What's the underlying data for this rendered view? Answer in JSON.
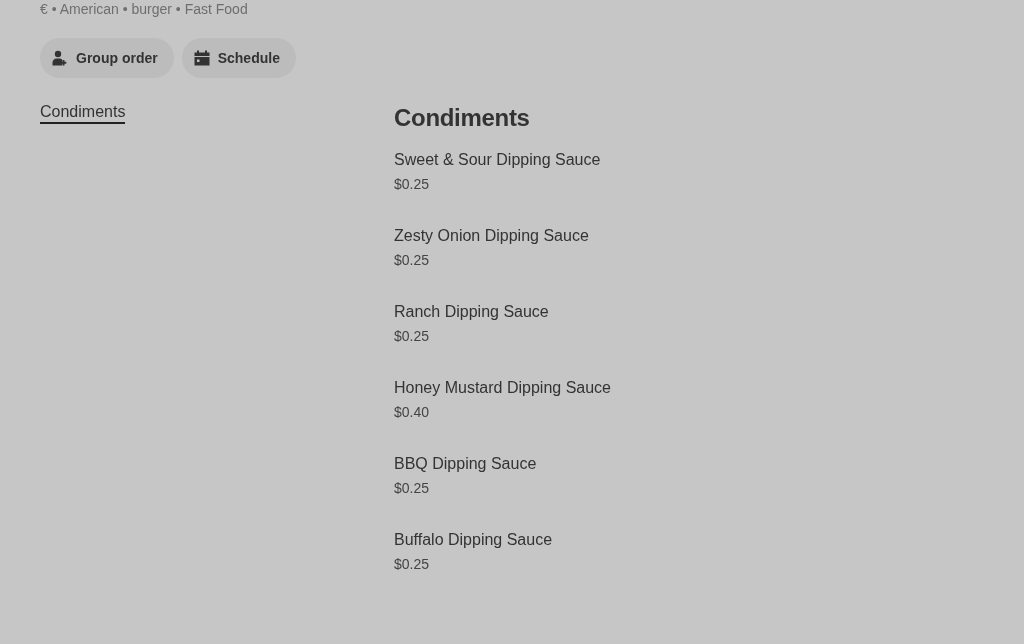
{
  "store_meta": "€ • American • burger • Fast Food",
  "actions": [
    {
      "kind": "group",
      "label": "Group order"
    },
    {
      "kind": "schedule",
      "label": "Schedule"
    }
  ],
  "category_nav": [
    {
      "label": "Condiments",
      "selected": true
    }
  ],
  "section": {
    "title": "Condiments",
    "items": [
      {
        "name": "Sweet & Sour Dipping Sauce",
        "price": "$0.25"
      },
      {
        "name": "Zesty Onion Dipping Sauce",
        "price": "$0.25"
      },
      {
        "name": "Ranch Dipping Sauce",
        "price": "$0.25"
      },
      {
        "name": "Honey Mustard Dipping Sauce",
        "price": "$0.40"
      },
      {
        "name": "BBQ Dipping Sauce",
        "price": "$0.25"
      },
      {
        "name": "Buffalo Dipping Sauce",
        "price": "$0.25"
      }
    ]
  }
}
